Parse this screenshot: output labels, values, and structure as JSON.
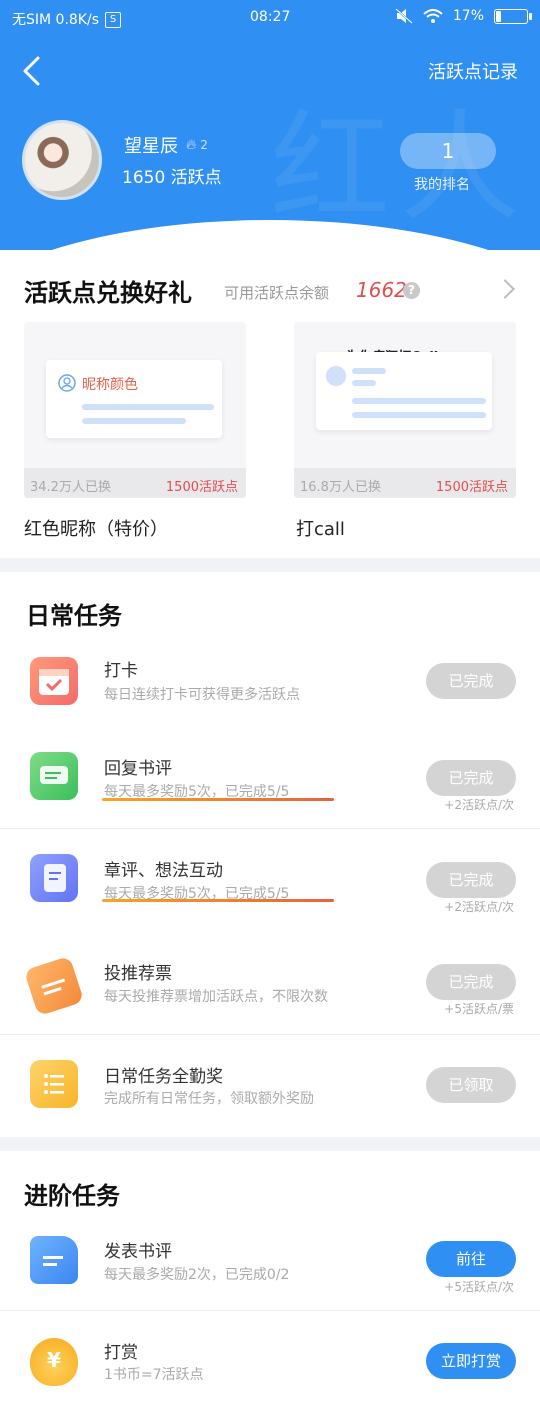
{
  "status_bar": {
    "left": "无SIM 0.8K/s",
    "sim_badge": "S",
    "time": "08:27",
    "battery": "17%",
    "battery_level": 0.17
  },
  "header": {
    "back_label": "返回",
    "link": "活跃点记录",
    "watermark": "红人馆"
  },
  "user": {
    "name": "望星辰",
    "fire_level": "2",
    "points_text": "1650 活跃点",
    "rank_value": "1",
    "rank_label": "我的排名"
  },
  "exchange": {
    "title": "活跃点兑换好礼",
    "balance_label": "可用活跃点余额",
    "balance": "1662",
    "help": "?",
    "gifts": [
      {
        "card_text": "昵称颜色",
        "sold": "34.2万人已换",
        "price": "1500活跃点",
        "name": "红色昵称（特价）"
      },
      {
        "card_text": "为你疯狂打Call",
        "sold": "16.8万人已换",
        "price": "1500活跃点",
        "name": "打call"
      }
    ]
  },
  "daily": {
    "title": "日常任务",
    "tasks": [
      {
        "title": "打卡",
        "desc": "每日连续打卡可获得更多活跃点",
        "button": "已完成",
        "reward": "",
        "icon": "calendar-check-icon"
      },
      {
        "title": "回复书评",
        "desc": "每天最多奖励5次，已完成5/5",
        "button": "已完成",
        "reward": "+2活跃点/次",
        "icon": "chat-bubbles-icon"
      },
      {
        "title": "章评、想法互动",
        "desc": "每天最多奖励5次，已完成5/5",
        "button": "已完成",
        "reward": "+2活跃点/次",
        "icon": "notes-stack-icon"
      },
      {
        "title": "投推荐票",
        "desc": "每天投推荐票增加活跃点，不限次数",
        "button": "已完成",
        "reward": "+5活跃点/票",
        "icon": "ticket-icon"
      },
      {
        "title": "日常任务全勤奖",
        "desc": "完成所有日常任务，领取额外奖励",
        "button": "已领取",
        "reward": "",
        "icon": "checklist-icon"
      }
    ]
  },
  "advanced": {
    "title": "进阶任务",
    "tasks": [
      {
        "title": "发表书评",
        "desc": "每天最多奖励2次，已完成0/2",
        "button": "前往",
        "reward": "+5活跃点/次",
        "icon": "document-icon"
      },
      {
        "title": "打赏",
        "desc": "1书币=7活跃点",
        "button": "立即打赏",
        "reward": "",
        "icon": "money-bag-icon"
      }
    ]
  },
  "colors": {
    "primary": "#2f8ff2",
    "accent_red": "#e24e4e",
    "done_grey": "#d4d4d4"
  }
}
